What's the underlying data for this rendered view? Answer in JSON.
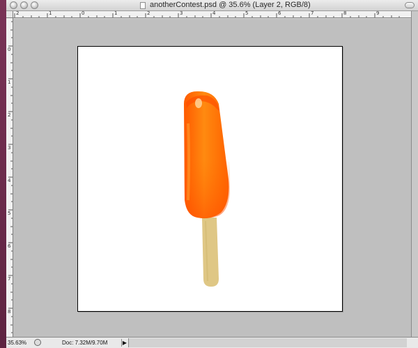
{
  "window": {
    "title": "anotherContest.psd @ 35.6% (Layer 2, RGB/8)"
  },
  "ruler_h_labels": [
    "2",
    "1",
    "0",
    "1",
    "2",
    "3",
    "4",
    "5",
    "6",
    "7",
    "8",
    "9"
  ],
  "ruler_v_labels": [
    "0",
    "1",
    "2",
    "3",
    "4",
    "5",
    "6",
    "7",
    "8"
  ],
  "statusbar": {
    "zoom": "35.63%",
    "doc_info": "Doc: 7.32M/9.70M",
    "arrow": "▶"
  },
  "canvas": {
    "background": "#bfbfbf",
    "document_color": "#ffffff",
    "popsicle_colors": {
      "ice": "#ff6a00",
      "highlight": "#ff9a1a",
      "stick": "#dfc785"
    }
  },
  "icons": [
    "close-icon",
    "minimize-icon",
    "zoom-icon",
    "document-icon",
    "status-icon",
    "arrow-right-icon",
    "popsicle-image"
  ]
}
